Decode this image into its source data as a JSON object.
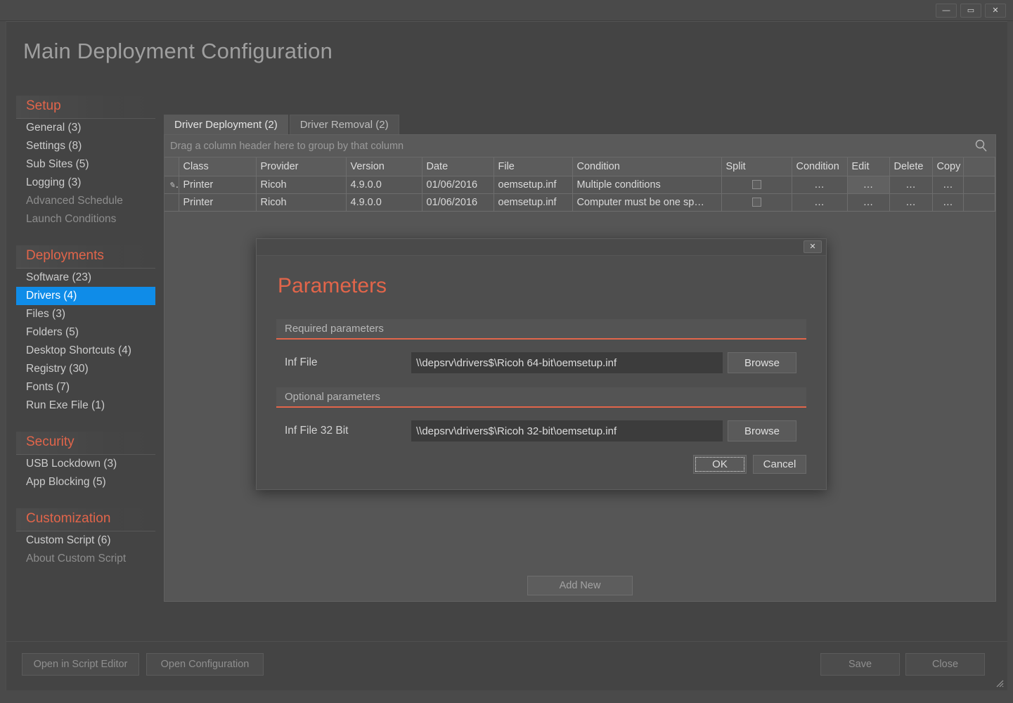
{
  "window": {
    "controls": {
      "minimize_label": "—",
      "maximize_label": "▭",
      "close_label": "✕"
    }
  },
  "header": {
    "title": "Main Deployment Configuration"
  },
  "sidebar": {
    "sections": [
      {
        "title": "Setup",
        "items": [
          {
            "label": "General (3)",
            "state": "normal"
          },
          {
            "label": "Settings (8)",
            "state": "normal"
          },
          {
            "label": "Sub Sites (5)",
            "state": "normal"
          },
          {
            "label": "Logging (3)",
            "state": "normal"
          },
          {
            "label": "Advanced Schedule",
            "state": "disabled"
          },
          {
            "label": "Launch Conditions",
            "state": "disabled"
          }
        ]
      },
      {
        "title": "Deployments",
        "items": [
          {
            "label": "Software (23)",
            "state": "normal"
          },
          {
            "label": "Drivers (4)",
            "state": "selected"
          },
          {
            "label": "Files (3)",
            "state": "normal"
          },
          {
            "label": "Folders (5)",
            "state": "normal"
          },
          {
            "label": "Desktop Shortcuts (4)",
            "state": "normal"
          },
          {
            "label": "Registry (30)",
            "state": "normal"
          },
          {
            "label": "Fonts (7)",
            "state": "normal"
          },
          {
            "label": "Run Exe File (1)",
            "state": "normal"
          }
        ]
      },
      {
        "title": "Security",
        "items": [
          {
            "label": "USB Lockdown (3)",
            "state": "normal"
          },
          {
            "label": "App Blocking (5)",
            "state": "normal"
          }
        ]
      },
      {
        "title": "Customization",
        "items": [
          {
            "label": "Custom Script (6)",
            "state": "normal"
          },
          {
            "label": "About Custom Script",
            "state": "disabled"
          }
        ]
      }
    ],
    "accent_color": "#e2654a",
    "selected_color": "#0f8ce8"
  },
  "main": {
    "tabs": [
      {
        "label": "Driver Deployment (2)",
        "active": true
      },
      {
        "label": "Driver Removal (2)",
        "active": false
      }
    ],
    "group_bar": {
      "hint": "Drag a column header here to group by that column",
      "search_icon": "search-icon"
    },
    "grid": {
      "columns": [
        "Class",
        "Provider",
        "Version",
        "Date",
        "File",
        "Condition",
        "Split",
        "Condition",
        "Edit",
        "Delete",
        "Copy"
      ],
      "rows": [
        {
          "indicator": "✎",
          "class": "Printer",
          "provider": "Ricoh",
          "version": "4.9.0.0",
          "date": "01/06/2016",
          "file": "oemsetup.inf",
          "condition": "Multiple conditions",
          "split": false,
          "condition_action": "…",
          "edit_action": "…",
          "delete_action": "…",
          "copy_action": "…",
          "edit_hover": true
        },
        {
          "indicator": "",
          "class": "Printer",
          "provider": "Ricoh",
          "version": "4.9.0.0",
          "date": "01/06/2016",
          "file": "oemsetup.inf",
          "condition": "Computer must be one sp…",
          "split": false,
          "condition_action": "…",
          "edit_action": "…",
          "delete_action": "…",
          "copy_action": "…",
          "edit_hover": false
        }
      ]
    },
    "add_new_label": "Add New"
  },
  "bottom_bar": {
    "open_script_editor_label": "Open in Script Editor",
    "open_configuration_label": "Open Configuration",
    "save_label": "Save",
    "close_label": "Close"
  },
  "dialog": {
    "title": "Parameters",
    "close_label": "✕",
    "required_section": {
      "header": "Required parameters",
      "fields": [
        {
          "label": "Inf File",
          "value": "\\\\depsrv\\drivers$\\Ricoh 64-bit\\oemsetup.inf",
          "browse_label": "Browse"
        }
      ]
    },
    "optional_section": {
      "header": "Optional parameters",
      "fields": [
        {
          "label": "Inf File 32 Bit",
          "value": "\\\\depsrv\\drivers$\\Ricoh 32-bit\\oemsetup.inf",
          "browse_label": "Browse"
        }
      ]
    },
    "ok_label": "OK",
    "cancel_label": "Cancel",
    "accent_color": "#e2654a"
  }
}
